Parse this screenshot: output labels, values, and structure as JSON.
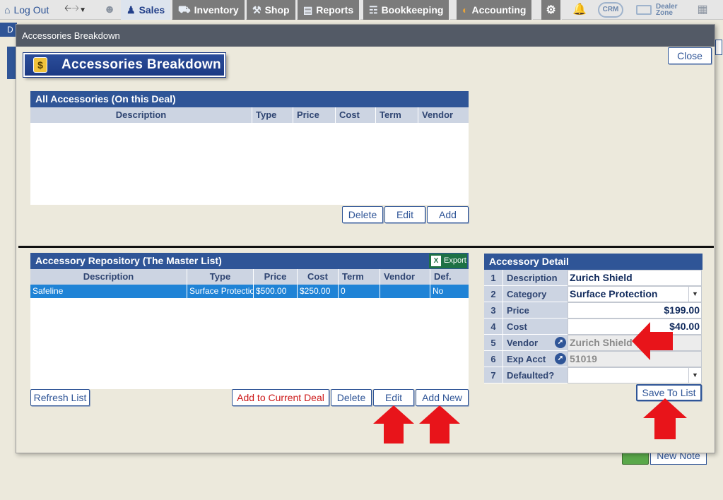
{
  "topnav": {
    "logout": "Log Out",
    "tabs": [
      "Sales",
      "Inventory",
      "Shop",
      "Reports",
      "Bookkeeping",
      "Accounting"
    ],
    "crm": "CRM",
    "dealer_zone": [
      "Dealer",
      "Zone"
    ]
  },
  "background": {
    "tab_letter": "D",
    "new_note": "New Note"
  },
  "modal": {
    "titlebar": "Accessories Breakdown",
    "banner_title": "Accessories Breakdown",
    "close": "Close"
  },
  "all_accessories": {
    "header": "All Accessories (On this Deal)",
    "columns": [
      "Description",
      "Type",
      "Price",
      "Cost",
      "Term",
      "Vendor"
    ],
    "rows": [],
    "buttons": {
      "delete": "Delete",
      "edit": "Edit",
      "add": "Add"
    }
  },
  "repository": {
    "header": "Accessory Repository (The Master List)",
    "export": "Export",
    "columns": [
      "Description",
      "Type",
      "Price",
      "Cost",
      "Term",
      "Vendor",
      "Def."
    ],
    "rows": [
      {
        "description": "Safeline",
        "type": "Surface Protection",
        "price": "$500.00",
        "cost": "$250.00",
        "term": "0",
        "vendor": "",
        "def": "No"
      }
    ],
    "buttons": {
      "refresh": "Refresh List",
      "add_to_deal": "Add to Current Deal",
      "delete": "Delete",
      "edit": "Edit",
      "add_new": "Add New"
    }
  },
  "detail": {
    "header": "Accessory Detail",
    "rows": [
      {
        "num": "1",
        "label": "Description",
        "value": "Zurich Shield"
      },
      {
        "num": "2",
        "label": "Category",
        "value": "Surface Protection"
      },
      {
        "num": "3",
        "label": "Price",
        "value": "$199.00"
      },
      {
        "num": "4",
        "label": "Cost",
        "value": "$40.00"
      },
      {
        "num": "5",
        "label": "Vendor",
        "value": "Zurich Shield"
      },
      {
        "num": "6",
        "label": "Exp Acct",
        "value": "51019"
      },
      {
        "num": "7",
        "label": "Defaulted?",
        "value": ""
      }
    ],
    "save": "Save To List"
  },
  "colors": {
    "brand_blue": "#2f5597",
    "selected_row": "#1f83d6",
    "annotation_arrow": "#e8141a",
    "excel_green": "#1e7145"
  }
}
